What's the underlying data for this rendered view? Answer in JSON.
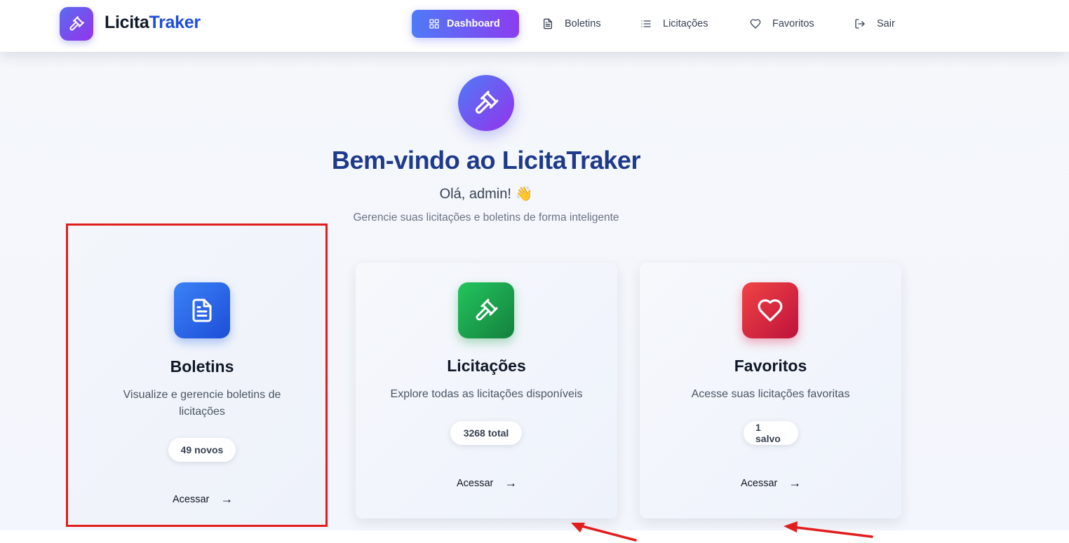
{
  "navbar": {
    "brand": {
      "name_part1": "Licita",
      "name_part2": "Traker",
      "logo_icon": "gavel-icon"
    },
    "items": [
      {
        "label": "Dashboard",
        "icon": "grid-icon",
        "active": true
      },
      {
        "label": "Boletins",
        "icon": "document-icon",
        "active": false
      },
      {
        "label": "Licitações",
        "icon": "list-icon",
        "active": false
      },
      {
        "label": "Favoritos",
        "icon": "heart-icon",
        "active": false
      },
      {
        "label": "Sair",
        "icon": "logout-icon",
        "active": false
      }
    ]
  },
  "hero": {
    "icon": "gavel-icon",
    "title": "Bem-vindo ao LicitaTraker",
    "greeting": "Olá, admin! 👋",
    "subtitle": "Gerencie suas licitações e boletins de forma inteligente"
  },
  "cards": [
    {
      "title": "Boletins",
      "description": "Visualize e gerencie boletins de licitações",
      "badge": "49 novos",
      "action": "Acessar",
      "arrow": "→",
      "icon": "document-icon",
      "color": "#2563eb"
    },
    {
      "title": "Licitações",
      "description": "Explore todas as licitações disponíveis",
      "badge": "3268 total",
      "action": "Acessar",
      "arrow": "→",
      "icon": "gavel-icon",
      "color": "#16a34a"
    },
    {
      "title": "Favoritos",
      "description": "Acesse suas licitações favoritas",
      "badge": "1 salvo",
      "action": "Acessar",
      "arrow": "→",
      "icon": "heart-icon",
      "color": "#e11d48"
    }
  ],
  "annotation": {
    "color": "#e11d1d"
  }
}
